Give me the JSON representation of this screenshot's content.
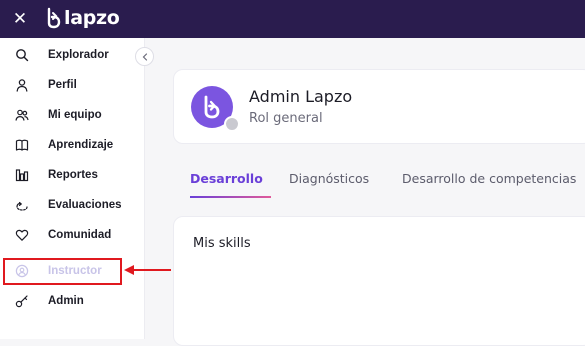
{
  "topbar": {
    "brand": "lapzo",
    "close_icon": "close-icon",
    "background": "#2a1c4e"
  },
  "sidebar": {
    "items": [
      {
        "label": "Explorador",
        "icon": "search-icon"
      },
      {
        "label": "Perfil",
        "icon": "user-icon"
      },
      {
        "label": "Mi equipo",
        "icon": "team-icon"
      },
      {
        "label": "Aprendizaje",
        "icon": "book-icon"
      },
      {
        "label": "Reportes",
        "icon": "bar-chart-icon"
      },
      {
        "label": "Evaluaciones",
        "icon": "evaluation-icon"
      },
      {
        "label": "Comunidad",
        "icon": "heart-icon"
      },
      {
        "label": "Instructor",
        "icon": "instructor-icon",
        "disabled": true
      },
      {
        "label": "Admin",
        "icon": "key-icon"
      }
    ],
    "collapse_icon": "chevron-left-icon"
  },
  "annotation": {
    "highlight_color": "#e0191f",
    "target": "Instructor"
  },
  "profile": {
    "name": "Admin Lapzo",
    "role": "Rol general",
    "avatar_color": "#7b55e0"
  },
  "tabs": [
    {
      "label": "Desarrollo",
      "active": true
    },
    {
      "label": "Diagnósticos",
      "active": false
    },
    {
      "label": "Desarrollo de competencias",
      "active": false
    }
  ],
  "skills": {
    "title": "Mis skills"
  },
  "colors": {
    "accent": "#6a3fd8",
    "accent_gradient_end": "#e05a9a",
    "disabled_text": "#c8c4e8"
  }
}
